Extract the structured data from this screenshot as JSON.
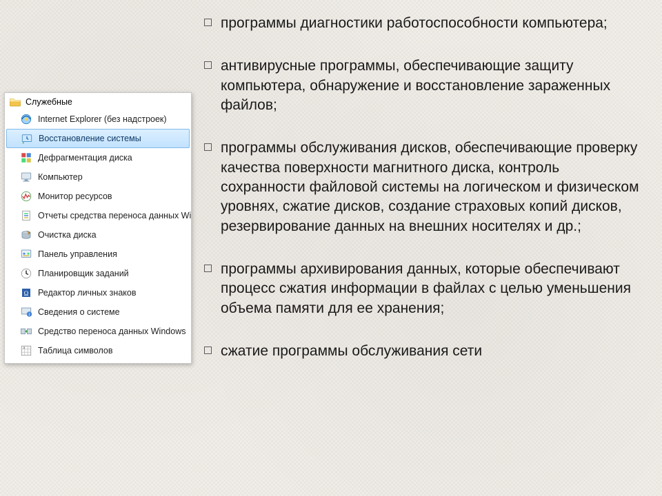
{
  "menu": {
    "header": "Служебные",
    "items": [
      {
        "label": "Internet Explorer (без надстроек)",
        "icon": "ie",
        "selected": false
      },
      {
        "label": "Восстановление системы",
        "icon": "restore",
        "selected": true
      },
      {
        "label": "Дефрагментация диска",
        "icon": "defrag",
        "selected": false
      },
      {
        "label": "Компьютер",
        "icon": "computer",
        "selected": false
      },
      {
        "label": "Монитор ресурсов",
        "icon": "resmon",
        "selected": false
      },
      {
        "label": "Отчеты средства переноса данных Wind",
        "icon": "report",
        "selected": false
      },
      {
        "label": "Очистка диска",
        "icon": "cleanup",
        "selected": false
      },
      {
        "label": "Панель управления",
        "icon": "control",
        "selected": false
      },
      {
        "label": "Планировщик заданий",
        "icon": "scheduler",
        "selected": false
      },
      {
        "label": "Редактор личных знаков",
        "icon": "eudcedit",
        "selected": false
      },
      {
        "label": "Сведения о системе",
        "icon": "sysinfo",
        "selected": false
      },
      {
        "label": "Средство переноса данных Windows",
        "icon": "transfer",
        "selected": false
      },
      {
        "label": "Таблица символов",
        "icon": "charmap",
        "selected": false
      }
    ]
  },
  "bullets": [
    " программы диагностики работоспособности компьютера;",
    " антивирусные программы, обеспечивающие защиту компьютера, обнаружение и восстановление зараженных файлов;",
    " программы обслуживания дисков, обеспечивающие проверку качества поверхности магнитного диска, контроль сохранности файловой системы на логическом и физическом уровнях, сжатие дисков, создание страховых копий дисков, резервирование данных на внешних носителях и др.;",
    " программы архивирования данных, которые обеспечивают процесс сжатия информации в файлах с целью уменьшения объема памяти для ее хранения;",
    " сжатие программы обслуживания сети"
  ]
}
